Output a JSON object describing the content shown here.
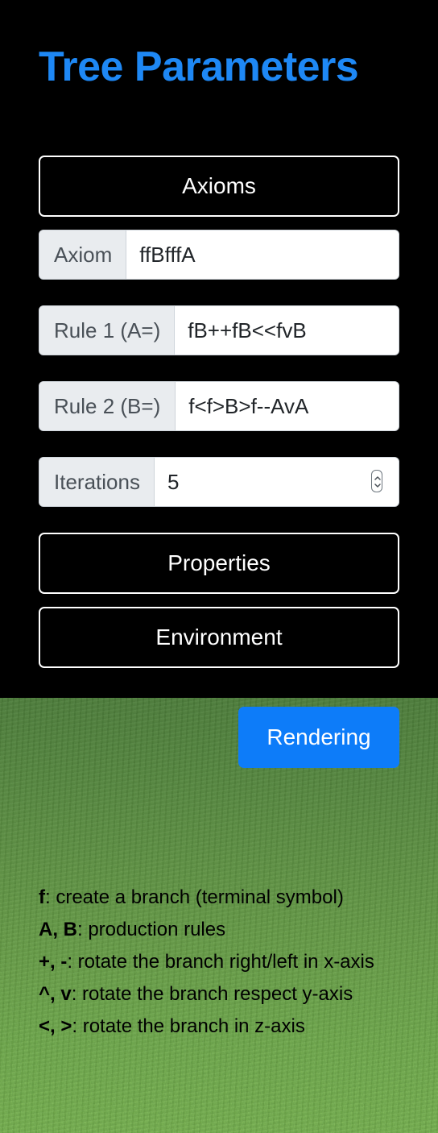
{
  "title": "Tree Parameters",
  "sections": {
    "axioms": "Axioms",
    "properties": "Properties",
    "environment": "Environment"
  },
  "fields": {
    "axiom": {
      "label": "Axiom",
      "value": "ffBfffA"
    },
    "rule1": {
      "label": "Rule 1 (A=)",
      "value": "fB++fB<<fvB"
    },
    "rule2": {
      "label": "Rule 2 (B=)",
      "value": "f<f>B>f--AvA"
    },
    "iterations": {
      "label": "Iterations",
      "value": "5"
    }
  },
  "render_button": "Rendering",
  "legend": [
    {
      "symbol": "f",
      "text": ": create a branch (terminal symbol)"
    },
    {
      "symbol": "A, B",
      "text": ": production rules"
    },
    {
      "symbol": "+, -",
      "text": ": rotate the branch right/left in x-axis"
    },
    {
      "symbol": "^, v",
      "text": ": rotate the branch respect y-axis"
    },
    {
      "symbol": "<, >",
      "text": ": rotate the branch in z-axis"
    }
  ],
  "colors": {
    "title": "#1e88f5",
    "primary_button": "#0d7cf9",
    "panel_background": "#000000",
    "grass": "#6aa048"
  }
}
